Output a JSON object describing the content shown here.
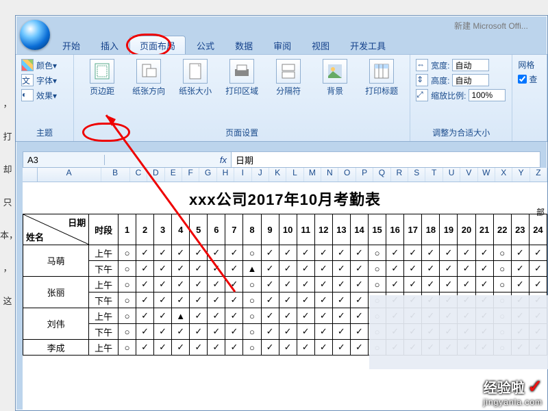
{
  "titlebar_fragment": "新建  Microsoft Offi...",
  "left_text": [
    "，打",
    "却只",
    "本，",
    "，这"
  ],
  "tabs": [
    "开始",
    "插入",
    "页面布局",
    "公式",
    "数据",
    "审阅",
    "视图",
    "开发工具"
  ],
  "active_tab_index": 2,
  "theme": {
    "colors": "颜色▾",
    "fonts": "字体▾",
    "effects": "效果▾",
    "label": "主题"
  },
  "pagesetup": {
    "buttons": [
      "页边距",
      "纸张方向",
      "纸张大小",
      "打印区域",
      "分隔符",
      "背景",
      "打印标题"
    ],
    "label": "页面设置"
  },
  "scale": {
    "width_label": "宽度:",
    "width_value": "自动",
    "height_label": "高度:",
    "height_value": "自动",
    "scale_label": "缩放比例:",
    "scale_value": "100%",
    "label": "调整为合适大小"
  },
  "gridlines": {
    "title": "网格",
    "view": "查"
  },
  "formula": {
    "namebox": "A3",
    "fx": "fx",
    "value": "日期"
  },
  "columns": [
    "A",
    "B",
    "C",
    "D",
    "E",
    "F",
    "G",
    "H",
    "I",
    "J",
    "K",
    "L",
    "M",
    "N",
    "O",
    "P",
    "Q",
    "R",
    "S",
    "T",
    "U",
    "V",
    "W",
    "X",
    "Y",
    "Z"
  ],
  "sheet": {
    "title": "xxx公司2017年10月考勤表",
    "sub_right": "部",
    "diag_top": "日期",
    "diag_bottom": "姓名",
    "time_header": "时段",
    "days": [
      1,
      2,
      3,
      4,
      5,
      6,
      7,
      8,
      9,
      10,
      11,
      12,
      13,
      14,
      15,
      16,
      17,
      18,
      19,
      20,
      21,
      22,
      23,
      24
    ],
    "segments": [
      "上午",
      "下午"
    ],
    "names": [
      "马萌",
      "张丽",
      "刘伟",
      "李成"
    ],
    "rows": [
      [
        "○",
        "✓",
        "✓",
        "✓",
        "✓",
        "✓",
        "✓",
        "○",
        "✓",
        "✓",
        "✓",
        "✓",
        "✓",
        "✓",
        "○",
        "✓",
        "✓",
        "✓",
        "✓",
        "✓",
        "✓",
        "○",
        "✓",
        "✓"
      ],
      [
        "○",
        "✓",
        "✓",
        "✓",
        "✓",
        "✓",
        "✓",
        "▲",
        "✓",
        "✓",
        "✓",
        "✓",
        "✓",
        "✓",
        "○",
        "✓",
        "✓",
        "✓",
        "✓",
        "✓",
        "✓",
        "○",
        "✓",
        "✓"
      ],
      [
        "○",
        "✓",
        "✓",
        "✓",
        "✓",
        "✓",
        "✓",
        "○",
        "✓",
        "✓",
        "✓",
        "✓",
        "✓",
        "✓",
        "○",
        "✓",
        "✓",
        "✓",
        "✓",
        "✓",
        "✓",
        "○",
        "✓",
        "✓"
      ],
      [
        "○",
        "✓",
        "✓",
        "✓",
        "✓",
        "✓",
        "✓",
        "○",
        "✓",
        "✓",
        "✓",
        "✓",
        "✓",
        "✓",
        "○",
        "✓",
        "✓",
        "✓",
        "✓",
        "✓",
        "✓",
        "○",
        "✓",
        "✓"
      ],
      [
        "○",
        "✓",
        "✓",
        "▲",
        "✓",
        "✓",
        "✓",
        "○",
        "✓",
        "✓",
        "✓",
        "✓",
        "✓",
        "✓",
        "○",
        "✓",
        "✓",
        "✓",
        "✓",
        "✓",
        "✓",
        "○",
        "✓",
        "✓"
      ],
      [
        "○",
        "✓",
        "✓",
        "✓",
        "✓",
        "✓",
        "✓",
        "○",
        "✓",
        "✓",
        "✓",
        "✓",
        "✓",
        "✓",
        "○",
        "✓",
        "✓",
        "✓",
        "✓",
        "✓",
        "✓",
        "○",
        "✓",
        "✓"
      ],
      [
        "○",
        "✓",
        "✓",
        "✓",
        "✓",
        "✓",
        "✓",
        "○",
        "✓",
        "✓",
        "✓",
        "✓",
        "✓",
        "✓",
        "○",
        "✓",
        "✓",
        "✓",
        "✓",
        "✓",
        "✓",
        "○",
        "✓",
        "✓"
      ]
    ]
  },
  "watermark": {
    "main": "经验啦",
    "check": "✓",
    "sub": "jingyanla.com"
  }
}
